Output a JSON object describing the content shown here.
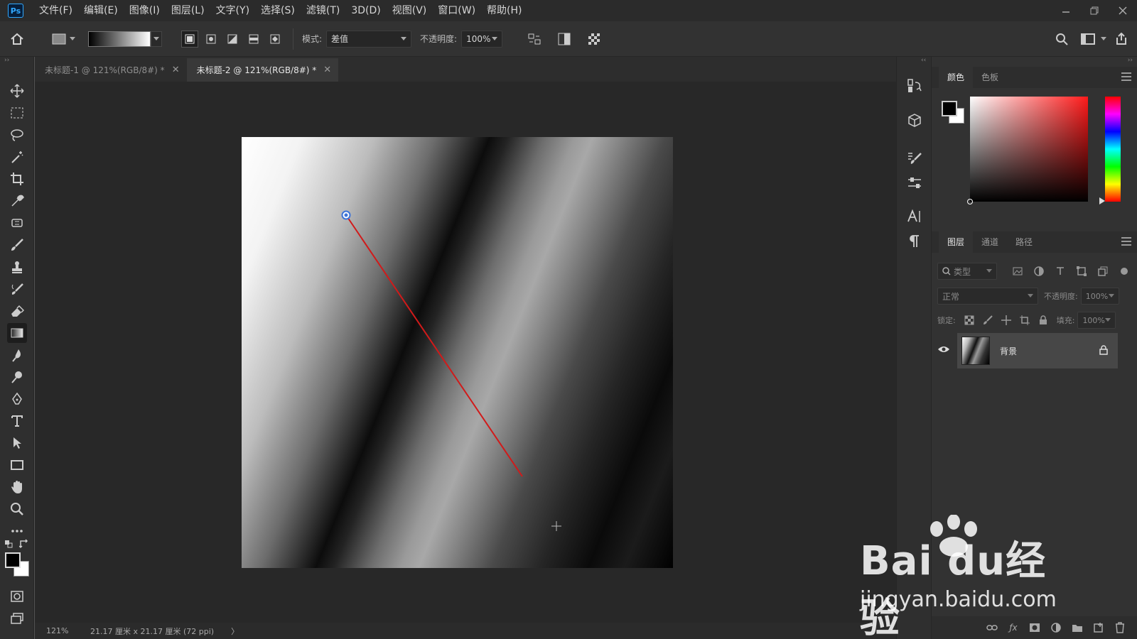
{
  "app": {
    "logo": "Ps"
  },
  "menu": [
    "文件(F)",
    "编辑(E)",
    "图像(I)",
    "图层(L)",
    "文字(Y)",
    "选择(S)",
    "滤镜(T)",
    "3D(D)",
    "视图(V)",
    "窗口(W)",
    "帮助(H)"
  ],
  "options": {
    "mode_label": "模式:",
    "mode_value": "差值",
    "opacity_label": "不透明度:",
    "opacity_value": "100%"
  },
  "tabs": [
    {
      "label": "未标题-1 @ 121%(RGB/8#) *",
      "active": false
    },
    {
      "label": "未标题-2 @ 121%(RGB/8#) *",
      "active": true
    }
  ],
  "status": {
    "zoom": "121%",
    "doc_size": "21.17 厘米 x 21.17 厘米 (72 ppi)",
    "arrow": "〉"
  },
  "color_panel": {
    "tabs": [
      "颜色",
      "色板"
    ]
  },
  "layers_panel": {
    "tabs": [
      "图层",
      "通道",
      "路径"
    ],
    "filter_placeholder": "类型",
    "blend_mode": "正常",
    "opacity_label": "不透明度:",
    "opacity_value": "100%",
    "lock_label": "锁定:",
    "fill_label": "填充:",
    "fill_value": "100%",
    "layers": [
      {
        "name": "背景",
        "visible": true,
        "locked": true
      }
    ]
  },
  "footer_icons": [
    "link-icon",
    "fx-icon",
    "mask-icon",
    "adjustment-icon",
    "folder-icon",
    "new-layer-icon",
    "trash-icon"
  ],
  "watermark": {
    "brand": "Bai du经验",
    "url": "jingyan.baidu.com"
  },
  "colors": {
    "accent": "#31a8ff",
    "gradient_line": "#d11a1a"
  }
}
